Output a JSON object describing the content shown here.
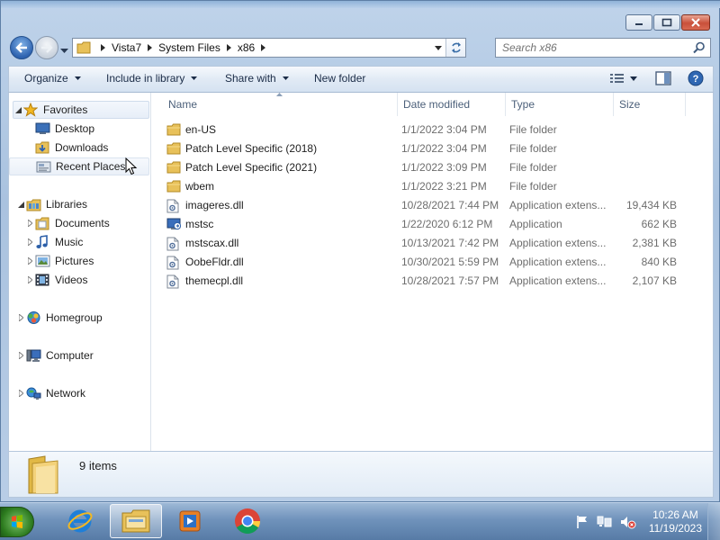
{
  "address": {
    "crumbs": [
      "Vista7",
      "System Files",
      "x86"
    ]
  },
  "search": {
    "placeholder": "Search x86"
  },
  "toolbar": {
    "organize": "Organize",
    "include_in_library": "Include in library",
    "share_with": "Share with",
    "new_folder": "New folder"
  },
  "sidebar": {
    "favorites": "Favorites",
    "desktop": "Desktop",
    "downloads": "Downloads",
    "recent_places": "Recent Places",
    "libraries": "Libraries",
    "documents": "Documents",
    "music": "Music",
    "pictures": "Pictures",
    "videos": "Videos",
    "homegroup": "Homegroup",
    "computer": "Computer",
    "network": "Network"
  },
  "columns": {
    "name": "Name",
    "date_modified": "Date modified",
    "type": "Type",
    "size": "Size"
  },
  "files": [
    {
      "name": "en-US",
      "date": "1/1/2022 3:04 PM",
      "type": "File folder",
      "size": "",
      "icon": "folder-icon"
    },
    {
      "name": "Patch Level Specific (2018)",
      "date": "1/1/2022 3:04 PM",
      "type": "File folder",
      "size": "",
      "icon": "folder-icon"
    },
    {
      "name": "Patch Level Specific (2021)",
      "date": "1/1/2022 3:09 PM",
      "type": "File folder",
      "size": "",
      "icon": "folder-icon"
    },
    {
      "name": "wbem",
      "date": "1/1/2022 3:21 PM",
      "type": "File folder",
      "size": "",
      "icon": "folder-icon"
    },
    {
      "name": "imageres.dll",
      "date": "10/28/2021 7:44 PM",
      "type": "Application extens...",
      "size": "19,434 KB",
      "icon": "dll-icon"
    },
    {
      "name": "mstsc",
      "date": "1/22/2020 6:12 PM",
      "type": "Application",
      "size": "662 KB",
      "icon": "remote-desktop-icon"
    },
    {
      "name": "mstscax.dll",
      "date": "10/13/2021 7:42 PM",
      "type": "Application extens...",
      "size": "2,381 KB",
      "icon": "dll-icon"
    },
    {
      "name": "OobeFldr.dll",
      "date": "10/30/2021 5:59 PM",
      "type": "Application extens...",
      "size": "840 KB",
      "icon": "dll-icon"
    },
    {
      "name": "themecpl.dll",
      "date": "10/28/2021 7:57 PM",
      "type": "Application extens...",
      "size": "2,107 KB",
      "icon": "dll-icon"
    }
  ],
  "details": {
    "count": "9 items"
  },
  "taskbar": {
    "apps": [
      "internet-explorer-icon",
      "windows-explorer-icon",
      "media-player-icon",
      "chrome-icon"
    ],
    "time": "10:26 AM",
    "date": "11/19/2023"
  }
}
